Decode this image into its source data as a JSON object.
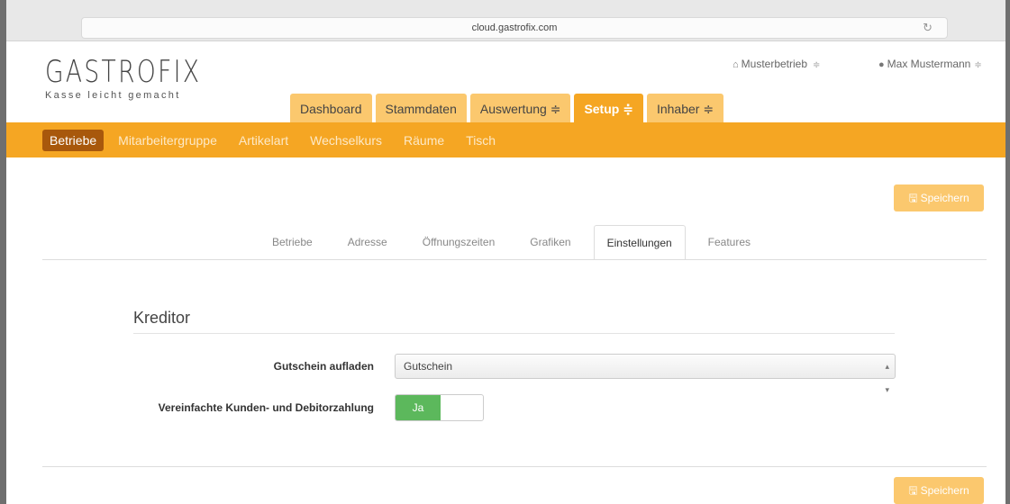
{
  "browser": {
    "url": "cloud.gastrofix.com",
    "reload_icon": "reload-icon"
  },
  "brand": {
    "name": "GASTROFIX",
    "tagline": "Kasse leicht gemacht"
  },
  "account": {
    "business": "Musterbetrieb",
    "user": "Max Mustermann"
  },
  "main_tabs": [
    {
      "label": "Dashboard"
    },
    {
      "label": "Stammdaten"
    },
    {
      "label": "Auswertung ≑"
    },
    {
      "label": "Setup ≑"
    },
    {
      "label": "Inhaber ≑"
    }
  ],
  "sub_nav": [
    {
      "label": "Betriebe"
    },
    {
      "label": "Mitarbeitergruppe"
    },
    {
      "label": "Artikelart"
    },
    {
      "label": "Wechselkurs"
    },
    {
      "label": "Räume"
    },
    {
      "label": "Tisch"
    }
  ],
  "save_label": "Speichern",
  "section_tabs": [
    {
      "label": "Betriebe"
    },
    {
      "label": "Adresse"
    },
    {
      "label": "Öffnungszeiten"
    },
    {
      "label": "Grafiken"
    },
    {
      "label": "Einstellungen"
    },
    {
      "label": "Features"
    }
  ],
  "form": {
    "section_title": "Kreditor",
    "voucher": {
      "label": "Gutschein aufladen",
      "value": "Gutschein"
    },
    "simplified": {
      "label": "Vereinfachte Kunden- und Debitorzahlung",
      "toggle_label": "Ja"
    }
  },
  "colors": {
    "accent": "#f5a623",
    "accent_light": "#fbc86e",
    "active_subnav": "#a8580c",
    "toggle_on": "#5cb85c"
  }
}
